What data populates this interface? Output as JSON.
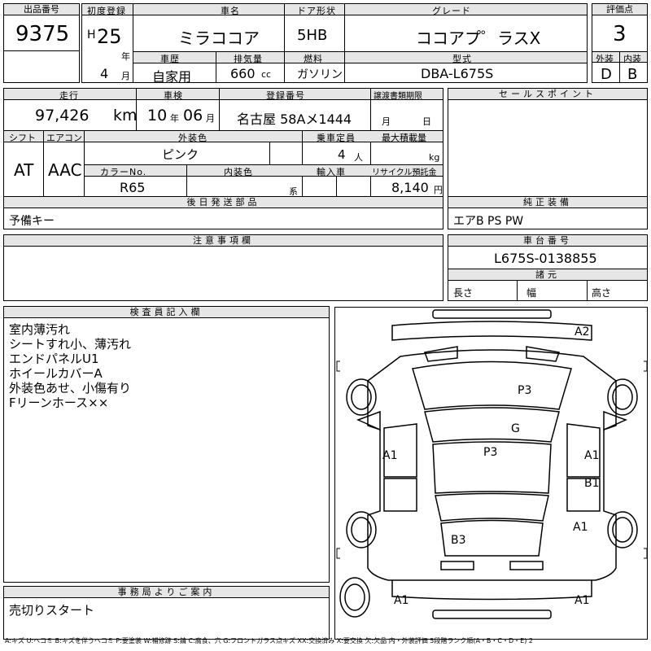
{
  "header": {
    "lot_label": "出品番号",
    "lot_no": "9375",
    "first_reg_label": "初度登録",
    "era": "H",
    "year": "25",
    "year_unit": "年",
    "month": "4",
    "month_unit": "月",
    "car_name_label": "車名",
    "car_name": "ミラココア",
    "door_label": "ドア形状",
    "door": "5HB",
    "grade_label": "グレード",
    "grade": "ココアプ゜ラスX",
    "score_label": "評価点",
    "score": "3",
    "history_label": "車歴",
    "history": "自家用",
    "displacement_label": "排気量",
    "displacement": "660",
    "displacement_unit": "cc",
    "fuel_label": "燃料",
    "fuel": "ガソリン",
    "model_label": "型式",
    "model": "DBA-L675S",
    "exterior_label": "外装",
    "exterior": "D",
    "interior_label": "内装",
    "interior": "B"
  },
  "specs": {
    "mileage_label": "走行",
    "mileage": "97,426",
    "mileage_unit": "km",
    "inspection_label": "車検",
    "inspection_year": "10",
    "inspection_year_unit": "年",
    "inspection_month": "06",
    "inspection_month_unit": "月",
    "plate_label": "登録番号",
    "plate": "名古屋 58Aメ1444",
    "transfer_label": "譲渡書類期限",
    "transfer_month_unit": "月",
    "transfer_day_unit": "日",
    "shift_label": "シフト",
    "shift": "AT",
    "aircon_label": "エアコン",
    "aircon": "AAC",
    "ext_color_label": "外装色",
    "ext_color": "ピンク",
    "capacity_label": "乗車定員",
    "capacity": "4",
    "capacity_unit": "人",
    "load_label": "最大積載量",
    "load_unit": "kg",
    "color_no_label": "カラーNo.",
    "color_no": "R65",
    "int_color_label": "内装色",
    "int_color_unit": "系",
    "import_label": "輸入車",
    "recycle_label": "リサイクル預託金",
    "recycle": "8,140",
    "recycle_unit": "円"
  },
  "sales_point": {
    "label": "セールスポイント"
  },
  "parts": {
    "label": "後日発送部品",
    "value": "予備キー"
  },
  "equipment": {
    "label": "純正装備",
    "value": "エアB PS PW"
  },
  "notes": {
    "label": "注意事項欄"
  },
  "chassis": {
    "label": "車台番号",
    "value": "L675S-0138855",
    "dims_label": "諸元",
    "length_label": "長さ",
    "width_label": "幅",
    "height_label": "高さ"
  },
  "inspector": {
    "label": "検査員記入欄",
    "lines": [
      "室内薄汚れ",
      "シートすれ小、薄汚れ",
      "エンドパネルU1",
      "ホイールカバーA",
      "外装色あせ、小傷有り",
      "Fリーンホース××"
    ]
  },
  "office": {
    "label": "事務局よりご案内",
    "value": "売切りスタート"
  },
  "damage": {
    "front_bumper": "A2",
    "hood": "P3",
    "windshield": "G",
    "roof": "P3",
    "left_front_door": "A1",
    "right_front_door": "A1",
    "right_rear_door": "B1",
    "right_quarter": "A1",
    "trunk": "B3",
    "rear_bumper_left": "A1",
    "rear_bumper_right": "A1"
  },
  "legend": "A:キズ U:ヘコミ B:キズを伴うヘコミ P:要塗装 W:補修跡 S:錆 C:腐食、穴 G:フロントガラス点キズ XX:交換済み X:要交換 欠:欠品 内・外装評価 5段階ランク順(A・B・C・D・E) 2"
}
